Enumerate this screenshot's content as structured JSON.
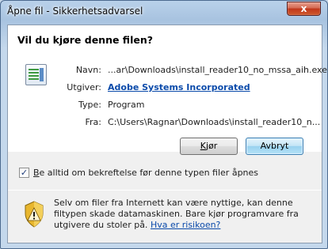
{
  "window": {
    "title": "Åpne fil - Sikkerhetsadvarsel",
    "close_label": "x"
  },
  "dialog": {
    "question": "Vil du kjøre denne filen?",
    "fields": {
      "name_label": "Navn:",
      "name_value": "...ar\\Downloads\\install_reader10_no_mssa_aih.exe",
      "publisher_label": "Utgiver:",
      "publisher_value": "Adobe Systems Incorporated",
      "type_label": "Type:",
      "type_value": "Program",
      "from_label": "Fra:",
      "from_value": "C:\\Users\\Ragnar\\Downloads\\install_reader10_n..."
    },
    "buttons": {
      "run": "Kjør",
      "cancel": "Avbryt"
    },
    "checkbox": {
      "label": "Be alltid om bekreftelse før denne typen filer åpnes",
      "checked": true
    },
    "warning": {
      "text": "Selv om filer fra Internett kan være nyttige, kan denne filtypen skade datamaskinen. Bare kjør programvare fra utgivere du stoler på.",
      "link": "Hva er risikoen?"
    }
  }
}
